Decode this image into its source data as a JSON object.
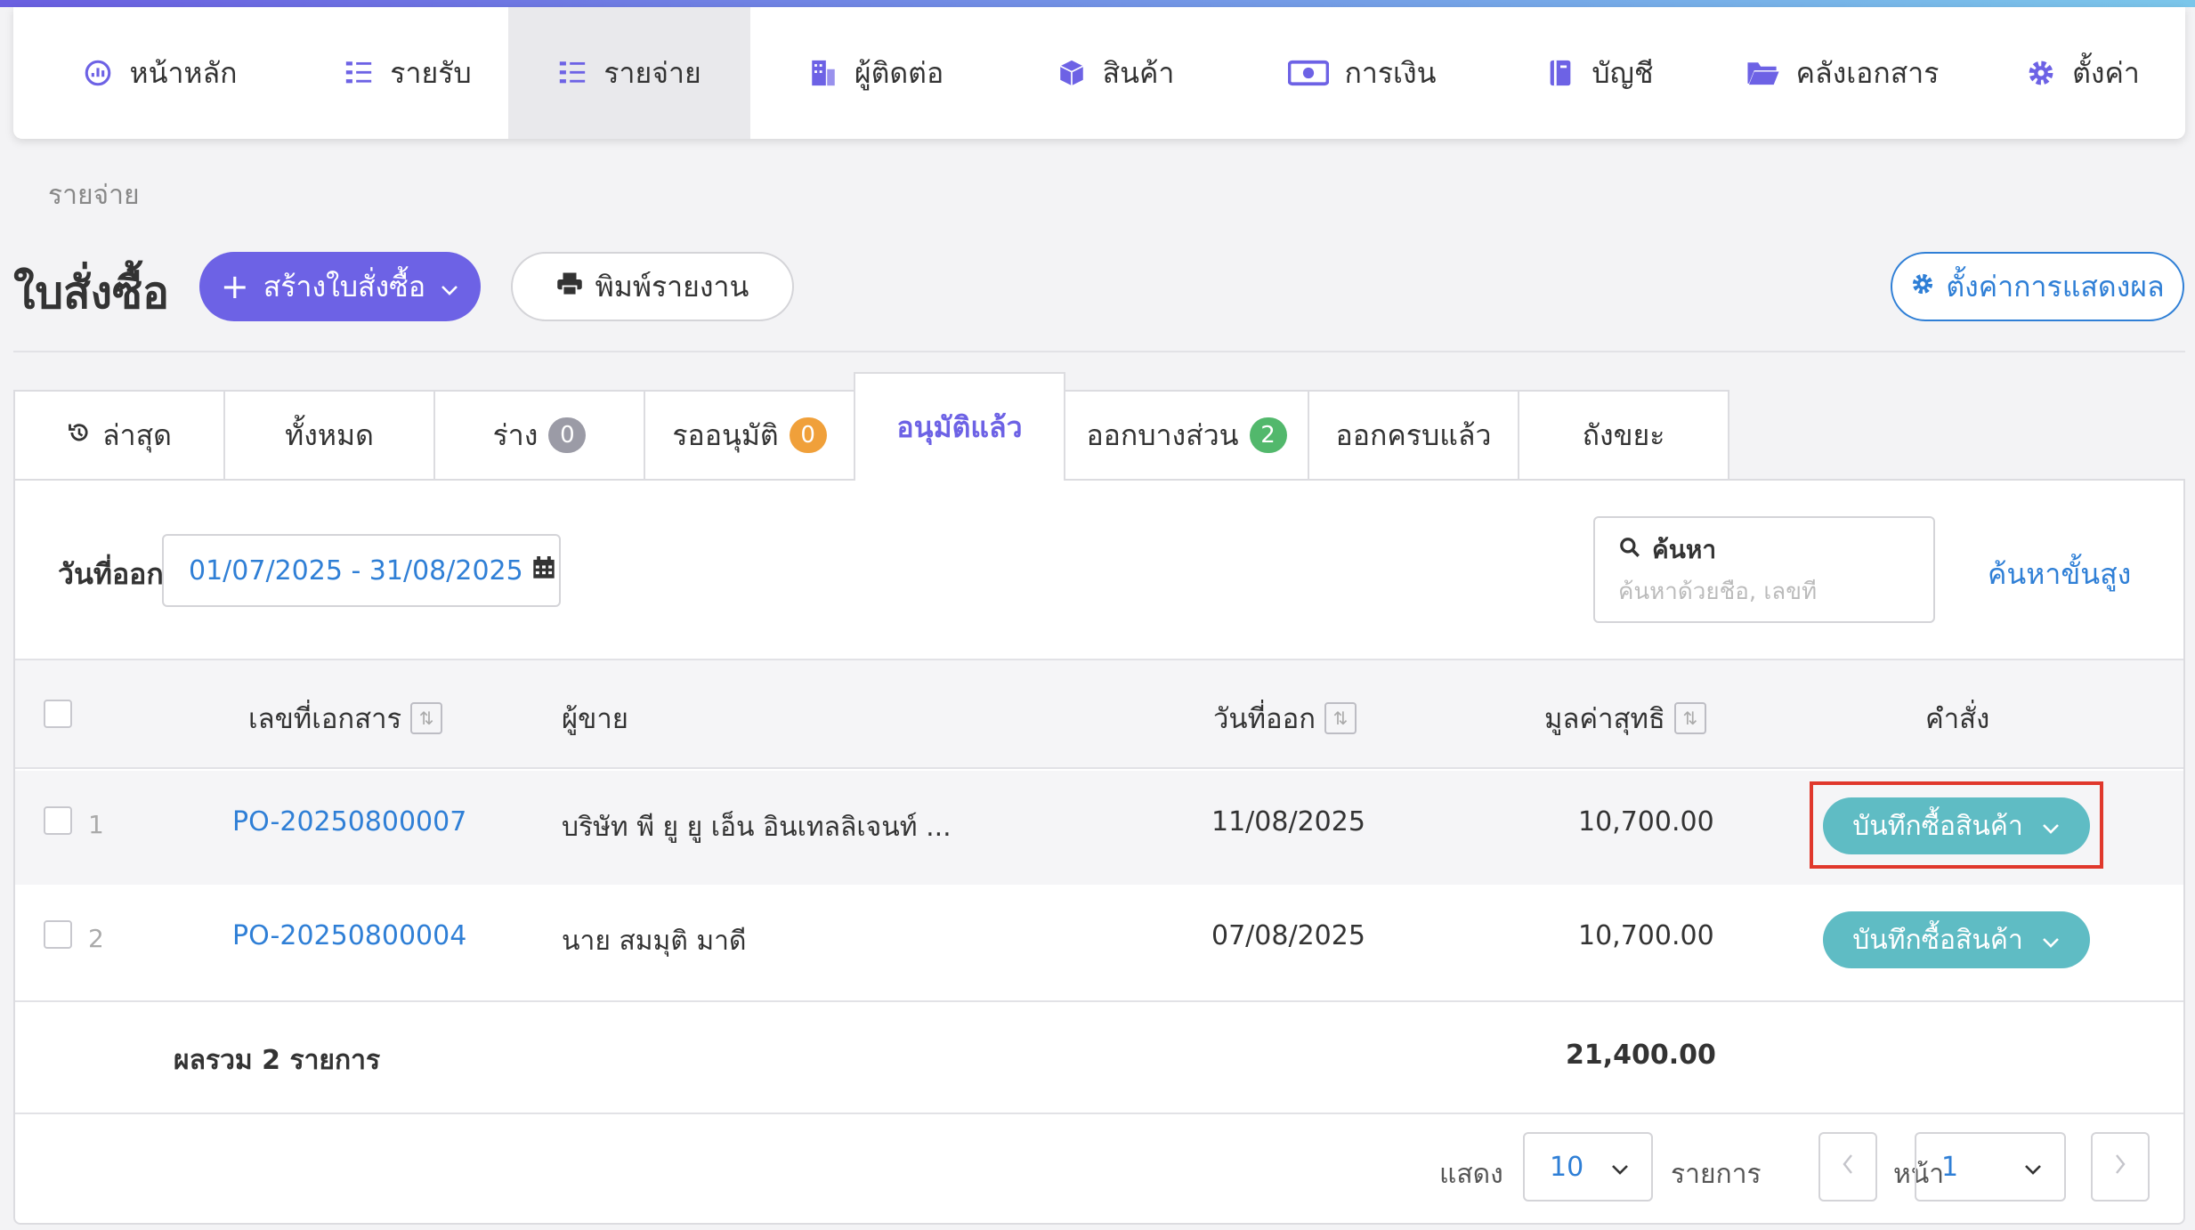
{
  "nav": {
    "items": [
      {
        "label": "หน้าหลัก",
        "icon": "dashboard-icon"
      },
      {
        "label": "รายรับ",
        "icon": "income-list-icon"
      },
      {
        "label": "รายจ่าย",
        "icon": "expense-list-icon",
        "active": true
      },
      {
        "label": "ผู้ติดต่อ",
        "icon": "contacts-building-icon"
      },
      {
        "label": "สินค้า",
        "icon": "product-box-icon"
      },
      {
        "label": "การเงิน",
        "icon": "money-icon"
      },
      {
        "label": "บัญชี",
        "icon": "accounting-book-icon"
      },
      {
        "label": "คลังเอกสาร",
        "icon": "folder-icon"
      },
      {
        "label": "ตั้งค่า",
        "icon": "gear-icon"
      }
    ]
  },
  "breadcrumb": "รายจ่าย",
  "page_title": "ใบสั่งซื้อ",
  "toolbar": {
    "create_label": "สร้างใบสั่งซื้อ",
    "print_label": "พิมพ์รายงาน",
    "display_settings_label": "ตั้งค่าการแสดงผล"
  },
  "tabs": [
    {
      "label": "ล่าสุด",
      "icon": "history-icon"
    },
    {
      "label": "ทั้งหมด"
    },
    {
      "label": "ร่าง",
      "badge": "0",
      "badge_color": "#9b9ba6"
    },
    {
      "label": "รออนุมัติ",
      "badge": "0",
      "badge_color": "#f0a03a"
    },
    {
      "label": "อนุมัติแล้ว",
      "active": true
    },
    {
      "label": "ออกบางส่วน",
      "badge": "2",
      "badge_color": "#52b86c"
    },
    {
      "label": "ออกครบแล้ว"
    },
    {
      "label": "ถังขยะ"
    }
  ],
  "filter": {
    "date_label": "วันที่ออก",
    "date_range": "01/07/2025 - 31/08/2025",
    "search_title": "ค้นหา",
    "search_placeholder": "ค้นหาด้วยชื่อ, เลขที่",
    "advanced_search_label": "ค้นหาขั้นสูง"
  },
  "table": {
    "headers": {
      "doc_no": "เลขที่เอกสาร",
      "vendor": "ผู้ขาย",
      "issue_date": "วันที่ออก",
      "net_amount": "มูลค่าสุทธิ",
      "actions": "คำสั่ง"
    },
    "rows": [
      {
        "num": "1",
        "doc_no": "PO-20250800007",
        "vendor": "บริษัท พี ยู ยู เอ็น อินเทลลิเจนท์ ...",
        "issue_date": "11/08/2025",
        "net_amount": "10,700.00",
        "action_label": "บันทึกซื้อสินค้า"
      },
      {
        "num": "2",
        "doc_no": "PO-20250800004",
        "vendor": "นาย สมมุติ มาดี",
        "issue_date": "07/08/2025",
        "net_amount": "10,700.00",
        "action_label": "บันทึกซื้อสินค้า"
      }
    ],
    "total_label": "ผลรวม 2 รายการ",
    "total_amount": "21,400.00"
  },
  "pagination": {
    "show_label": "แสดง",
    "page_size": "10",
    "items_label": "รายการ",
    "page_label": "หน้า",
    "current_page": "1"
  },
  "colors": {
    "primary": "#6d62e5",
    "link": "#2f7fd6",
    "action": "#5fbcc4",
    "highlight": "#e0382c"
  }
}
